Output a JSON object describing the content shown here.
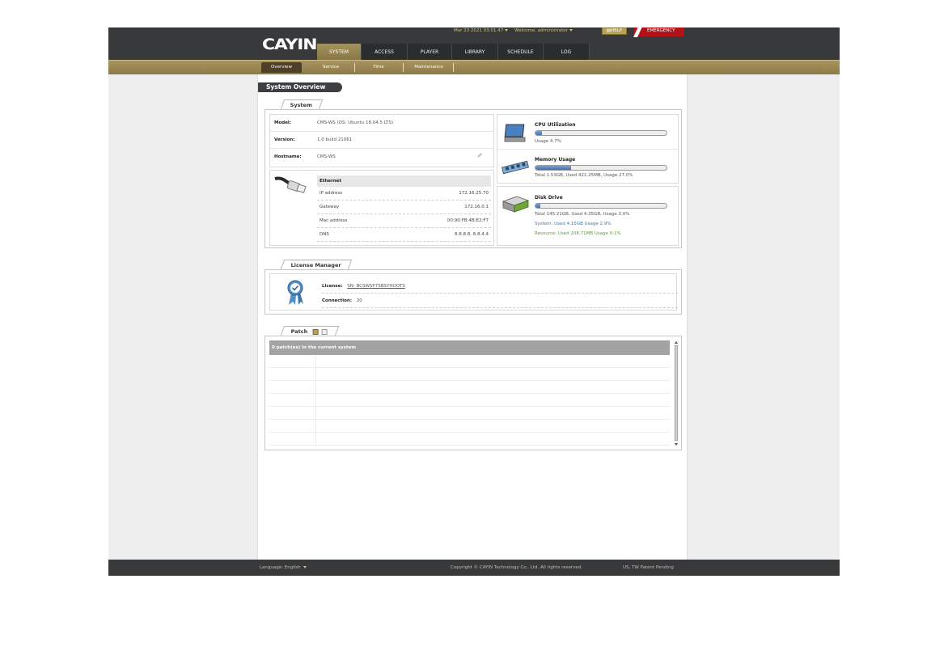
{
  "header": {
    "logo": "CAYIN",
    "datetime": "Mar 23 2021 03:01:47",
    "welcome": "Welcome, administrator",
    "help_label": "HELP",
    "emergency_label": "EMERGENCY",
    "tabs": [
      {
        "label": "SYSTEM"
      },
      {
        "label": "ACCESS"
      },
      {
        "label": "PLAYER"
      },
      {
        "label": "LIBRARY"
      },
      {
        "label": "SCHEDULE"
      },
      {
        "label": "LOG"
      }
    ],
    "active_tab": "SYSTEM"
  },
  "subnav": {
    "items": [
      {
        "label": "Overview"
      },
      {
        "label": "Service"
      },
      {
        "label": "Time"
      },
      {
        "label": "Maintenance"
      }
    ],
    "active": "Overview"
  },
  "page": {
    "title": "System Overview"
  },
  "system": {
    "section_label": "System",
    "info": [
      {
        "key": "Model:",
        "value": "CMS-WS (OS: Ubuntu 18.04.5 LTS)"
      },
      {
        "key": "Version:",
        "value": "1.0 build 21061"
      },
      {
        "key": "Hostname:",
        "value": "CMS-WS"
      }
    ],
    "ethernet": {
      "title": "Ethernet",
      "rows": [
        {
          "key": "IP address",
          "value": "172.16.25.70"
        },
        {
          "key": "Gateway",
          "value": "172.16.0.1"
        },
        {
          "key": "Mac address",
          "value": "00:90:FB:4B:E2:F7"
        },
        {
          "key": "DNS",
          "value": "8.8.8.8, 8.8.4.4"
        }
      ]
    },
    "cpu": {
      "title": "CPU Utilization",
      "usage_text": "Usage 4.7%",
      "usage_percent": 4.7
    },
    "memory": {
      "title": "Memory Usage",
      "usage_text": "Total 1.53GB, Used 421.25MB, Usage 27.0%",
      "usage_percent": 27.0
    },
    "disk": {
      "title": "Disk Drive",
      "usage_text": "Total 145.21GB, Used 4.35GB, Usage 3.0%",
      "usage_percent": 3.0,
      "system_text": "System: Used 4.15GB Usage 2.9%",
      "resource_text": "Resource: Used 208.71MB Usage 0.1%"
    }
  },
  "license": {
    "section_label": "License Manager",
    "license_key": "License:",
    "license_value": "SN: BCSWSP7SBSYHOOTS",
    "connection_key": "Connection:",
    "connection_value": "20"
  },
  "patch": {
    "section_label": "Patch",
    "header_text": "0 patch(es) in the current system"
  },
  "footer": {
    "language_label": "Language:",
    "language_value": "English",
    "copyright": "Copyright © CAYIN Technology Co., Ltd. All rights reserved.",
    "patent": "US, TW Patent Pending"
  },
  "colors": {
    "header_bg": "#37393b",
    "accent_gold": "#a99460",
    "emergency_red": "#b3121a",
    "bar_blue": "#3c6fb4",
    "resource_green": "#5f9a2e"
  },
  "icons": {
    "cpu": "monitor-icon",
    "memory": "ram-icon",
    "disk": "hard-drive-icon",
    "ethernet": "ethernet-cable-icon",
    "license": "badge-ribbon-icon",
    "edit": "pencil-icon"
  }
}
